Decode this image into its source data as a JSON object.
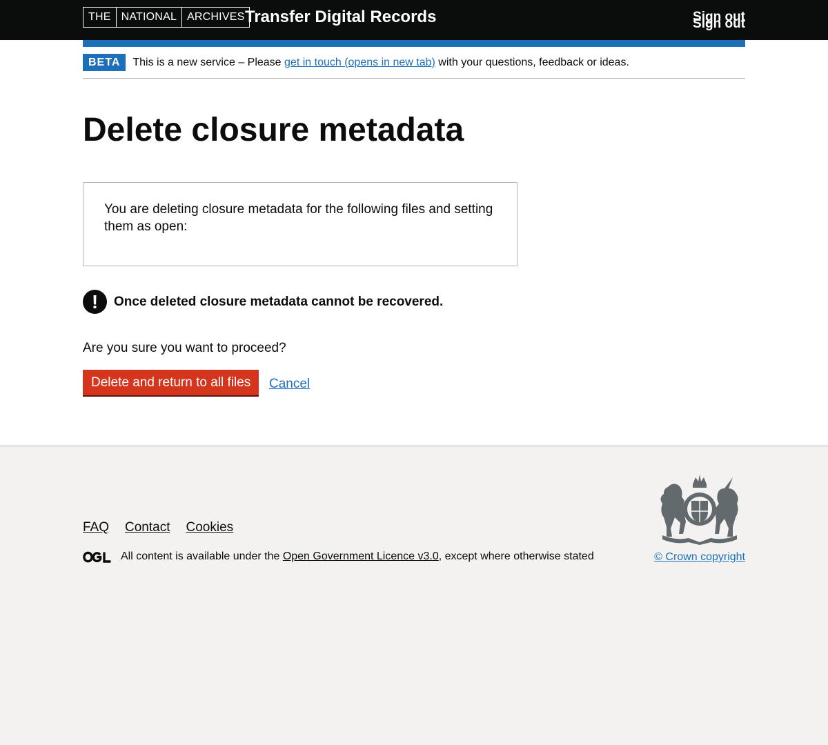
{
  "header": {
    "logo_parts": [
      "THE",
      "NATIONAL",
      "ARCHIVES"
    ],
    "service_name": "Transfer Digital Records",
    "sign_out": "Sign out"
  },
  "phase_banner": {
    "tag": "BETA",
    "text_before": "This is a new service – Please ",
    "link": "get in touch (opens in new tab)",
    "text_after": " with your questions, feedback or ideas."
  },
  "main": {
    "title": "Delete closure metadata",
    "panel_text": "You are deleting closure metadata for the following files and setting them as open:",
    "warning_icon": "!",
    "warning_text": "Once deleted closure metadata cannot be recovered.",
    "question": "Are you sure you want to proceed?",
    "delete_button": "Delete and return to all files",
    "cancel_link": "Cancel"
  },
  "footer": {
    "links": [
      "FAQ",
      "Contact",
      "Cookies"
    ],
    "licence_before": "All content is available under the ",
    "licence_link": "Open Government Licence v3.0",
    "licence_after": ", except where otherwise stated",
    "copyright": "© Crown copyright",
    "crest_icon": "royal-coat-of-arms-icon",
    "ogl_icon": "ogl-logo-icon"
  },
  "colors": {
    "header_bg": "#0b0c0c",
    "brand_blue": "#1d70b8",
    "danger_red": "#d4351c",
    "footer_bg": "#f3f2f1"
  }
}
